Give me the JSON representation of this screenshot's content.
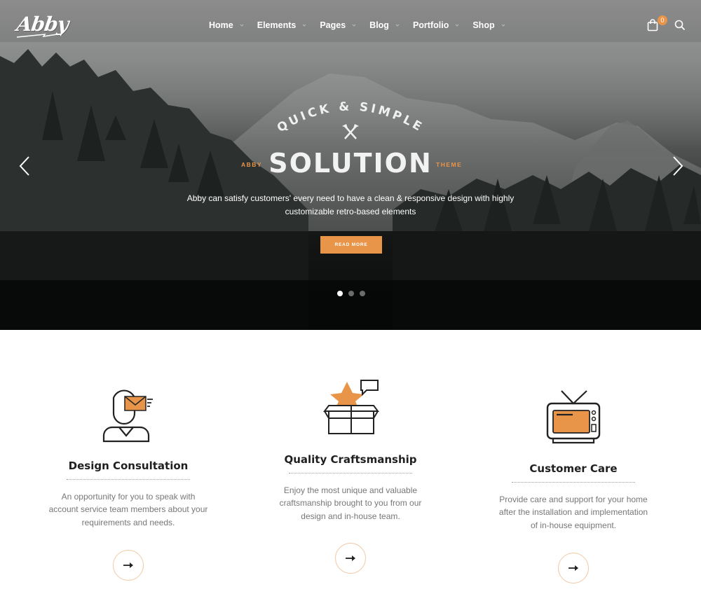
{
  "brand": {
    "logo_text": "Abby"
  },
  "nav": {
    "items": [
      {
        "label": "Home"
      },
      {
        "label": "Elements"
      },
      {
        "label": "Pages"
      },
      {
        "label": "Blog"
      },
      {
        "label": "Portfolio"
      },
      {
        "label": "Shop"
      }
    ],
    "cart_count": "0",
    "icons": {
      "cart": "shopping-bag-icon",
      "search": "search-icon",
      "dropdown": "chevron-down-icon"
    }
  },
  "hero": {
    "arc_text": "QUICK & SIMPLE",
    "headline": "SOLUTION",
    "side_left": "ABBY",
    "side_right": "THEME",
    "description_line1": "Abby can satisfy customers' every need to have a clean & responsive design with highly",
    "description_line2": "customizable retro-based elements",
    "button_label": "READ MORE",
    "slides": 3,
    "active_slide": 1
  },
  "features": [
    {
      "title": "Design Consultation",
      "icon": "consultant-mail-icon",
      "text_lines": [
        "An opportunity for you to speak with",
        "account service team members about your",
        "requirements and needs."
      ]
    },
    {
      "title": "Quality Craftsmanship",
      "icon": "box-star-icon",
      "text_lines": [
        "Enjoy the most unique and valuable",
        "craftsmanship brought to you from our",
        "design and in-house team."
      ]
    },
    {
      "title": "Customer Care",
      "icon": "tv-icon",
      "text_lines": [
        "Provide care and support for your home",
        "after the installation and implementation",
        "of in-house equipment."
      ]
    }
  ],
  "colors": {
    "accent": "#e8954a",
    "heading": "#1f1f1f",
    "body_text": "#777777"
  }
}
